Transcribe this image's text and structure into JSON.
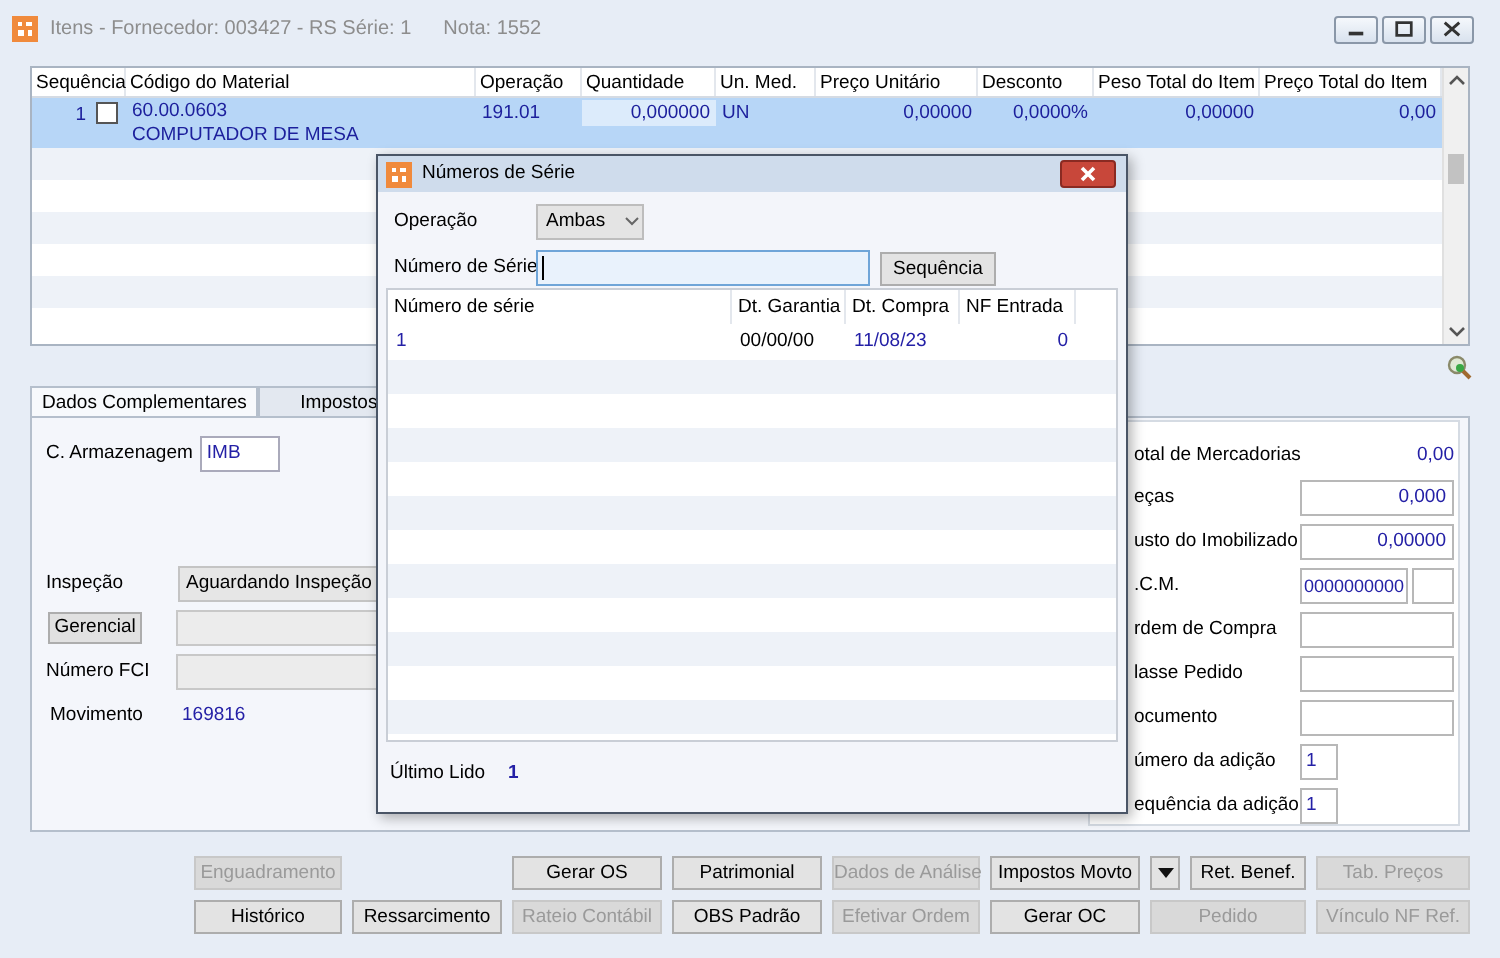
{
  "window": {
    "title": "Itens - Fornecedor: 003427 - RS Série: 1",
    "note": "Nota: 1552"
  },
  "items_table": {
    "columns": [
      "Sequência",
      "Código do Material",
      "Operação",
      "Quantidade",
      "Un. Med.",
      "Preço Unitário",
      "Desconto",
      "Peso Total do Item",
      "Preço Total do Item"
    ],
    "rows": [
      {
        "sequence": "1",
        "checked": false,
        "selected": true,
        "material_code": "60.00.0603",
        "material_name": "COMPUTADOR DE MESA",
        "operation": "191.01",
        "quantity": "0,000000",
        "unit": "UN",
        "unit_price": "0,00000",
        "discount": "0,0000%",
        "total_weight": "0,00000",
        "total_price": "0,00"
      }
    ]
  },
  "tabs": [
    {
      "label": "Dados Complementares",
      "selected": true
    },
    {
      "label": "Impostos",
      "selected": false
    }
  ],
  "left_panel": {
    "storage": {
      "label": "C. Armazenagem",
      "value": "IMB"
    },
    "inspection": {
      "label": "Inspeção",
      "value": "Aguardando Inspeção"
    },
    "manager_button": "Gerencial",
    "fci": {
      "label": "Número FCI"
    },
    "movement": {
      "label": "Movimento",
      "value": "169816"
    }
  },
  "right_panel": [
    {
      "kind": "text",
      "label": "otal de Mercadorias",
      "value": "0,00"
    },
    {
      "kind": "field",
      "label": "eças",
      "value": "0,000"
    },
    {
      "kind": "field",
      "label": "usto do Imobilizado",
      "value": "0,00000"
    },
    {
      "kind": "pair",
      "label": ".C.M.",
      "value": "0000000000"
    },
    {
      "kind": "field",
      "label": "rdem de Compra"
    },
    {
      "kind": "field",
      "label": "lasse Pedido"
    },
    {
      "kind": "field",
      "label": "ocumento"
    },
    {
      "kind": "small",
      "label": "úmero da adição",
      "value": "1"
    },
    {
      "kind": "small",
      "label": "equência da adição",
      "value": "1"
    }
  ],
  "button_rows": [
    [
      {
        "kind": "button",
        "label": "Enguadramento",
        "disabled": true
      },
      {
        "kind": "button",
        "label": "Gerar OS",
        "disabled": false
      },
      {
        "kind": "button",
        "label": "Patrimonial",
        "disabled": false
      },
      {
        "kind": "button",
        "label": "Dados de Análise",
        "disabled": true
      },
      {
        "kind": "button",
        "label": "Impostos Movto",
        "disabled": false
      },
      {
        "kind": "dropdown",
        "disabled": false
      },
      {
        "kind": "button",
        "label": "Ret. Benef.",
        "disabled": false
      },
      {
        "kind": "button",
        "label": "Tab. Preços",
        "disabled": true
      }
    ],
    [
      {
        "kind": "button",
        "label": "Histórico",
        "disabled": false
      },
      {
        "kind": "button",
        "label": "Ressarcimento",
        "disabled": false
      },
      {
        "kind": "button",
        "label": "Rateio Contábil",
        "disabled": true
      },
      {
        "kind": "button",
        "label": "OBS Padrão",
        "disabled": false
      },
      {
        "kind": "button",
        "label": "Efetivar Ordem",
        "disabled": true
      },
      {
        "kind": "button",
        "label": "Gerar OC",
        "disabled": false
      },
      {
        "kind": "button",
        "label": "Pedido",
        "disabled": true
      },
      {
        "kind": "button",
        "label": "Vínculo NF Ref.",
        "disabled": true
      }
    ]
  ],
  "dialog": {
    "title": "Números de Série",
    "operation": {
      "label": "Operação",
      "value": "Ambas"
    },
    "serial": {
      "label": "Número de Série",
      "focused": true
    },
    "sequence_button": "Sequência",
    "list": {
      "columns": [
        "Número de série",
        "Dt. Garantia",
        "Dt. Compra",
        "NF Entrada"
      ],
      "rows": [
        {
          "serial": "1",
          "warranty_date": "00/00/00",
          "purchase_date": "11/08/23",
          "nf_entry": "0"
        }
      ]
    },
    "last_read": {
      "label": "Último Lido",
      "value": "1"
    }
  }
}
